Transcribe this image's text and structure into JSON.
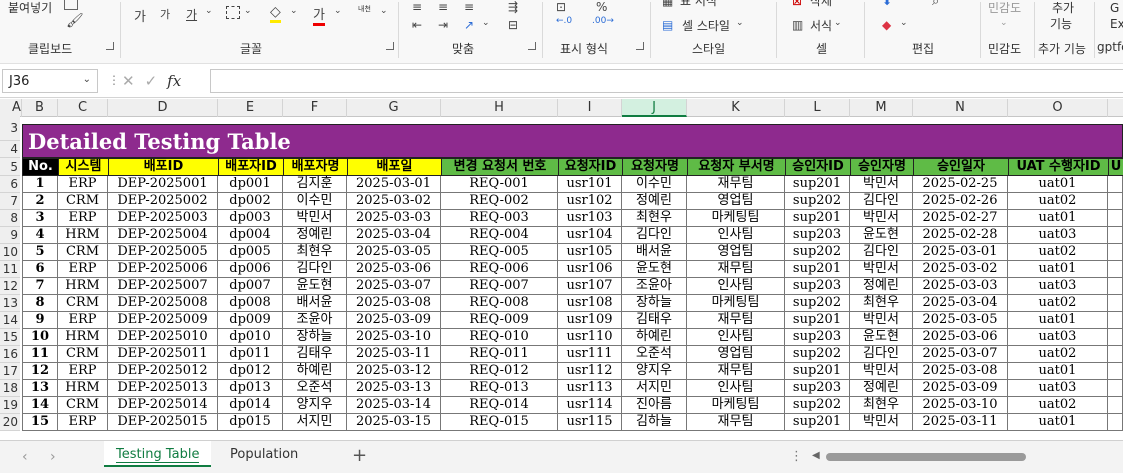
{
  "ribbon": {
    "top_items": [
      {
        "label": "붙여넣기",
        "icon": "paste-icon"
      },
      {
        "label": "가",
        "icon": "increase-font-icon"
      },
      {
        "label": "가",
        "icon": "decrease-font-icon"
      },
      {
        "label": "가",
        "icon": "underline-icon"
      },
      {
        "label": "내천",
        "icon": "phonetic-icon"
      },
      {
        "label": "표 서식",
        "icon": "format-table-icon"
      },
      {
        "label": "삭제",
        "icon": "delete-cells-icon"
      },
      {
        "label": "셀 스타일",
        "icon": "cell-style-icon"
      },
      {
        "label": "서식",
        "icon": "format-cells-icon"
      },
      {
        "label": "민감도",
        "icon": "sensitivity-icon"
      },
      {
        "label": "추가",
        "icon": "add-ins-icon"
      },
      {
        "label": "기능",
        "icon": "add-ins-icon"
      },
      {
        "label": "G",
        "icon": "gpt-icon"
      },
      {
        "label": "Ex",
        "icon": "gpt-icon"
      }
    ],
    "groups": [
      "클립보드",
      "글꼴",
      "맞춤",
      "표시 형식",
      "스타일",
      "셀",
      "편집",
      "민감도",
      "추가 기능",
      "gptfc"
    ]
  },
  "formula_bar": {
    "name_box": "J36",
    "formula": ""
  },
  "columns": [
    "A",
    "B",
    "C",
    "D",
    "E",
    "F",
    "G",
    "H",
    "I",
    "J",
    "K",
    "L",
    "M",
    "N",
    "O"
  ],
  "selected_column": "J",
  "row_numbers": [
    "3",
    "4",
    "5",
    "6",
    "7",
    "8",
    "9",
    "10",
    "11",
    "12",
    "13",
    "14",
    "15",
    "16",
    "17",
    "18",
    "19",
    "20"
  ],
  "table": {
    "title": "Detailed Testing Table",
    "headers": [
      "No.",
      "시스템",
      "배포ID",
      "배포자ID",
      "배포자명",
      "배포일",
      "변경 요청서 번호",
      "요청자ID",
      "요청자명",
      "요청자 부서명",
      "승인자ID",
      "승인자명",
      "승인일자",
      "UAT 수행자ID",
      "U"
    ],
    "rows": [
      [
        "1",
        "ERP",
        "DEP-2025001",
        "dp001",
        "김지훈",
        "2025-03-01",
        "REQ-001",
        "usr101",
        "이수민",
        "재무팀",
        "sup201",
        "박민서",
        "2025-02-25",
        "uat01"
      ],
      [
        "2",
        "CRM",
        "DEP-2025002",
        "dp002",
        "이수민",
        "2025-03-02",
        "REQ-002",
        "usr102",
        "정예린",
        "영업팀",
        "sup202",
        "김다인",
        "2025-02-26",
        "uat02"
      ],
      [
        "3",
        "ERP",
        "DEP-2025003",
        "dp003",
        "박민서",
        "2025-03-03",
        "REQ-003",
        "usr103",
        "최현우",
        "마케팅팀",
        "sup201",
        "박민서",
        "2025-02-27",
        "uat01"
      ],
      [
        "4",
        "HRM",
        "DEP-2025004",
        "dp004",
        "정예린",
        "2025-03-04",
        "REQ-004",
        "usr104",
        "김다인",
        "인사팀",
        "sup203",
        "윤도현",
        "2025-02-28",
        "uat03"
      ],
      [
        "5",
        "CRM",
        "DEP-2025005",
        "dp005",
        "최현우",
        "2025-03-05",
        "REQ-005",
        "usr105",
        "배서윤",
        "영업팀",
        "sup202",
        "김다인",
        "2025-03-01",
        "uat02"
      ],
      [
        "6",
        "ERP",
        "DEP-2025006",
        "dp006",
        "김다인",
        "2025-03-06",
        "REQ-006",
        "usr106",
        "윤도현",
        "재무팀",
        "sup201",
        "박민서",
        "2025-03-02",
        "uat01"
      ],
      [
        "7",
        "HRM",
        "DEP-2025007",
        "dp007",
        "윤도현",
        "2025-03-07",
        "REQ-007",
        "usr107",
        "조윤아",
        "인사팀",
        "sup203",
        "정예린",
        "2025-03-03",
        "uat03"
      ],
      [
        "8",
        "CRM",
        "DEP-2025008",
        "dp008",
        "배서윤",
        "2025-03-08",
        "REQ-008",
        "usr108",
        "장하늘",
        "마케팅팀",
        "sup202",
        "최현우",
        "2025-03-04",
        "uat02"
      ],
      [
        "9",
        "ERP",
        "DEP-2025009",
        "dp009",
        "조윤아",
        "2025-03-09",
        "REQ-009",
        "usr109",
        "김태우",
        "재무팀",
        "sup201",
        "박민서",
        "2025-03-05",
        "uat01"
      ],
      [
        "10",
        "HRM",
        "DEP-2025010",
        "dp010",
        "장하늘",
        "2025-03-10",
        "REQ-010",
        "usr110",
        "하예린",
        "인사팀",
        "sup203",
        "윤도현",
        "2025-03-06",
        "uat03"
      ],
      [
        "11",
        "CRM",
        "DEP-2025011",
        "dp011",
        "김태우",
        "2025-03-11",
        "REQ-011",
        "usr111",
        "오준석",
        "영업팀",
        "sup202",
        "김다인",
        "2025-03-07",
        "uat02"
      ],
      [
        "12",
        "ERP",
        "DEP-2025012",
        "dp012",
        "하예린",
        "2025-03-12",
        "REQ-012",
        "usr112",
        "양지우",
        "재무팀",
        "sup201",
        "박민서",
        "2025-03-08",
        "uat01"
      ],
      [
        "13",
        "HRM",
        "DEP-2025013",
        "dp013",
        "오준석",
        "2025-03-13",
        "REQ-013",
        "usr113",
        "서지민",
        "인사팀",
        "sup203",
        "정예린",
        "2025-03-09",
        "uat03"
      ],
      [
        "14",
        "CRM",
        "DEP-2025014",
        "dp014",
        "양지우",
        "2025-03-14",
        "REQ-014",
        "usr114",
        "진아름",
        "마케팅팀",
        "sup202",
        "최현우",
        "2025-03-10",
        "uat02"
      ],
      [
        "15",
        "ERP",
        "DEP-2025015",
        "dp015",
        "서지민",
        "2025-03-15",
        "REQ-015",
        "usr115",
        "김하늘",
        "재무팀",
        "sup201",
        "박민서",
        "2025-03-11",
        "uat01"
      ]
    ]
  },
  "sheet_tabs": [
    "Testing Table",
    "Population"
  ],
  "active_tab": "Testing Table",
  "add_sheet_label": "+",
  "colors": {
    "title_bg": "#8e2a8e",
    "header_black": "#000000",
    "header_yellow": "#ffff00",
    "header_green": "#5fbb46",
    "excel_green": "#107c41"
  }
}
